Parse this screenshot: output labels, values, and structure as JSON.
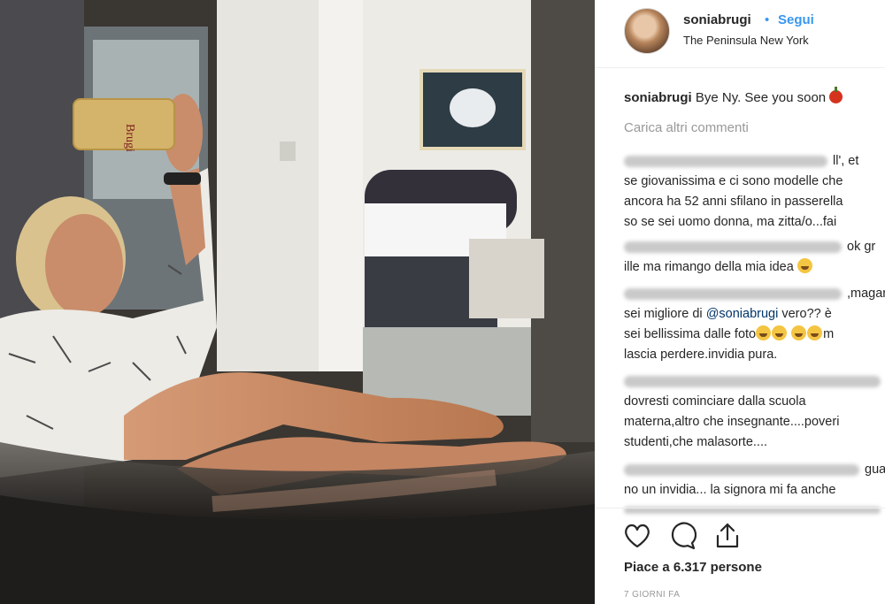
{
  "post": {
    "username": "soniabrugi",
    "separator": "•",
    "follow_label": "Segui",
    "location": "The Peninsula New York",
    "caption_user": "soniabrugi",
    "caption_text": "Bye Ny. See you soon",
    "load_more": "Carica altri commenti",
    "likes": "Piace a 6.317 persone",
    "date": "7 GIORNI FA",
    "phone_case_text": "Brugi"
  },
  "comments": [
    {
      "lines": [
        "ll', et",
        "se giovanissima e ci sono modelle che",
        "ancora ha 52 anni sfilano in passerella",
        "so se sei uomo donna, ma zitta/o...fai"
      ]
    },
    {
      "lines": [
        "ok gr",
        "ille ma rimango della mia idea"
      ]
    },
    {
      "lines": [
        ",magar",
        "sei migliore di",
        "@soniabrugi",
        "vero?? è",
        "sei bellissima dalle foto",
        "m",
        "lascia perdere.invidia pura."
      ]
    },
    {
      "lines": [
        "dovresti cominciare dalla scuola",
        "materna,altro che insegnante....poveri",
        "studenti,che malasorte...."
      ]
    },
    {
      "lines": [
        "gua",
        "no un invidia... la signora mi fa anche"
      ]
    }
  ],
  "icons": [
    "heart-icon",
    "comment-icon",
    "share-icon"
  ]
}
